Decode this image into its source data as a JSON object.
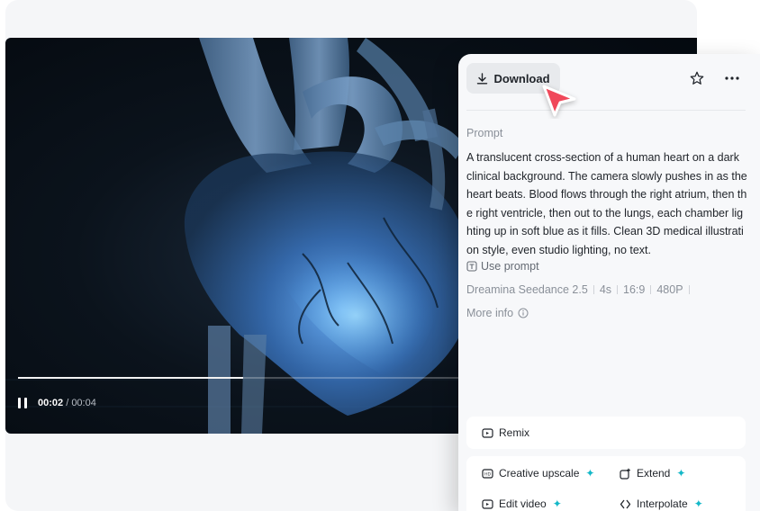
{
  "video": {
    "time_current": "00:02",
    "time_total": "/ 00:04",
    "progress": 0.5
  },
  "panel": {
    "download_label": "Download",
    "prompt_label": "Prompt",
    "prompt_text": "A translucent cross-section of a human heart on a dark clinical background. The camera slowly pushes in as the heart beats. Blood flows through the right atrium, then the right ventricle, then out to the lungs, each chamber lighting up in soft blue as it fills. Clean 3D medical illustration style, even studio lighting, no text.",
    "use_prompt_label": "Use prompt",
    "meta": {
      "model": "Dreamina Seedance 2.5",
      "duration": "4s",
      "ratio": "16:9",
      "resolution": "480P"
    },
    "more_info_label": "More info",
    "remix_label": "Remix",
    "tools": {
      "creative_upscale": "Creative upscale",
      "extend": "Extend",
      "edit_video": "Edit video",
      "interpolate": "Interpolate"
    }
  },
  "colors": {
    "accent_sparkle": "#14b8c8",
    "cursor": "#f0485a"
  }
}
